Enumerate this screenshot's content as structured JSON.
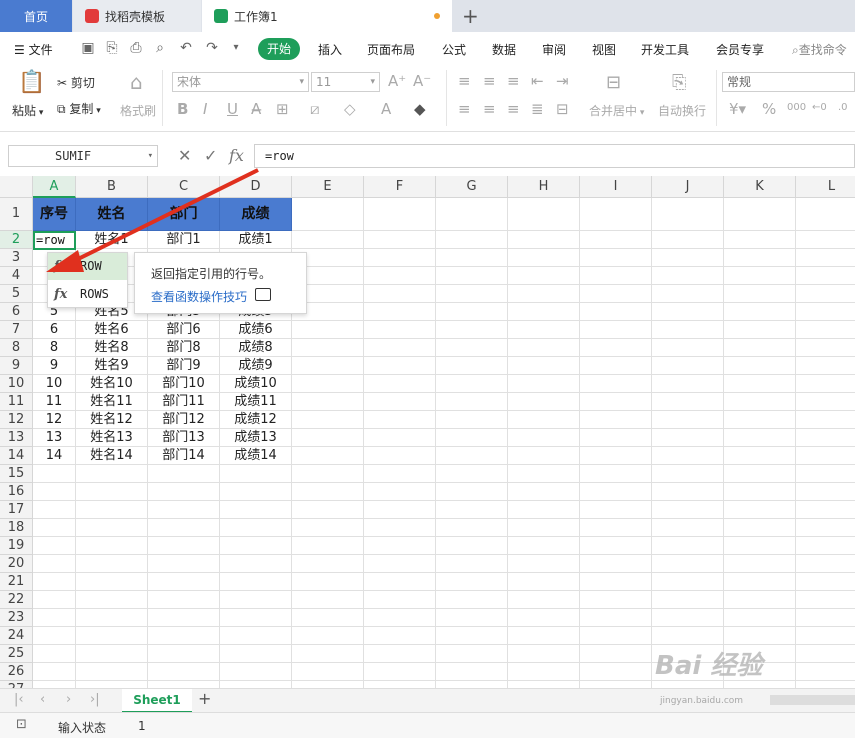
{
  "tabs": {
    "home": "首页",
    "template": "找稻壳模板",
    "workbook": "工作簿1"
  },
  "menu": {
    "file": "文件",
    "start": "开始",
    "items": [
      "插入",
      "页面布局",
      "公式",
      "数据",
      "审阅",
      "视图",
      "开发工具",
      "会员专享"
    ],
    "search": "查找命令"
  },
  "ribbon": {
    "paste": "粘贴",
    "cut": "剪切",
    "copy": "复制",
    "format_painter": "格式刷",
    "font": "宋体",
    "size": "11",
    "merge": "合并居中",
    "wrap": "自动换行",
    "number_format": "常规"
  },
  "formula_bar": {
    "name_box": "SUMIF",
    "formula": "=row"
  },
  "columns": [
    "A",
    "B",
    "C",
    "D",
    "E",
    "F",
    "G",
    "H",
    "I",
    "J",
    "K",
    "L"
  ],
  "rows": [
    "1",
    "2",
    "3",
    "4",
    "5",
    "6",
    "7",
    "8",
    "9",
    "10",
    "11",
    "12",
    "13",
    "14",
    "15",
    "16",
    "17",
    "18",
    "19",
    "20",
    "21",
    "22",
    "23",
    "24",
    "25",
    "26",
    "27"
  ],
  "table": {
    "headers": [
      "序号",
      "姓名",
      "部门",
      "成绩"
    ],
    "active_cell": "=row",
    "row2": [
      "",
      "姓名1",
      "部门1",
      "成绩1"
    ],
    "rows_visible": [
      [
        "5",
        "姓名5",
        "部门5",
        "成绩5"
      ],
      [
        "6",
        "姓名6",
        "部门6",
        "成绩6"
      ],
      [
        "8",
        "姓名8",
        "部门8",
        "成绩8"
      ],
      [
        "9",
        "姓名9",
        "部门9",
        "成绩9"
      ],
      [
        "10",
        "姓名10",
        "部门10",
        "成绩10"
      ],
      [
        "11",
        "姓名11",
        "部门11",
        "成绩11"
      ],
      [
        "12",
        "姓名12",
        "部门12",
        "成绩12"
      ],
      [
        "13",
        "姓名13",
        "部门13",
        "成绩13"
      ],
      [
        "14",
        "姓名14",
        "部门14",
        "成绩14"
      ]
    ]
  },
  "autocomplete": {
    "items": [
      "ROW",
      "ROWS"
    ],
    "fx": "fx",
    "tip": "返回指定引用的行号。",
    "link": "查看函数操作技巧"
  },
  "sheet": {
    "name": "Sheet1",
    "add": "+"
  },
  "status": {
    "mode": "输入状态",
    "count": "1"
  },
  "watermark": {
    "text": "Bai 经验",
    "sub": "jingyan.baidu.com"
  },
  "colors": {
    "accent": "#1e9e5a",
    "header_fill": "#4a7bd0",
    "arrow": "#e0301e"
  }
}
